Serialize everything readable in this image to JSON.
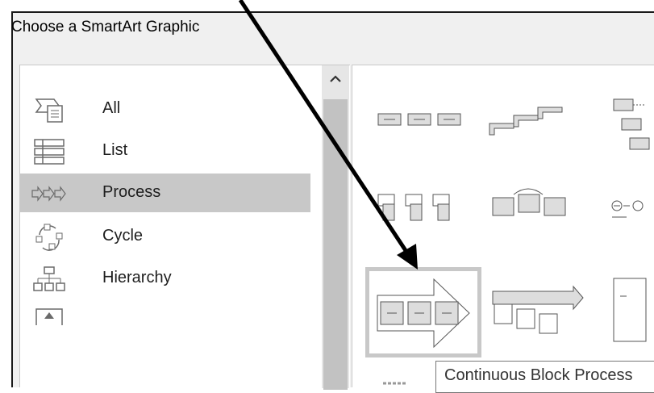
{
  "dialog": {
    "title": "Choose a SmartArt Graphic"
  },
  "categories": [
    {
      "label": "All",
      "icon": "all-icon",
      "selected": false
    },
    {
      "label": "List",
      "icon": "list-icon",
      "selected": false
    },
    {
      "label": "Process",
      "icon": "process-icon",
      "selected": true
    },
    {
      "label": "Cycle",
      "icon": "cycle-icon",
      "selected": false
    },
    {
      "label": "Hierarchy",
      "icon": "hierarchy-icon",
      "selected": false
    },
    {
      "label": "",
      "icon": "relationship-icon",
      "selected": false
    }
  ],
  "layouts": [
    {
      "icon": "basic-process-icon"
    },
    {
      "icon": "step-up-process-icon"
    },
    {
      "icon": "alternating-flow-icon"
    },
    {
      "icon": "accent-process-icon"
    },
    {
      "icon": "basic-chevron-icon"
    },
    {
      "icon": "circle-process-icon"
    },
    {
      "icon": "continuous-block-process-icon",
      "selected": true
    },
    {
      "icon": "increasing-arrow-process-icon"
    },
    {
      "icon": "segmented-process-icon"
    }
  ],
  "tooltip": {
    "text": "Continuous Block Process"
  },
  "colors": {
    "selection": "#c8c8c8",
    "dialog_bg": "#f0f0f0",
    "border": "#767676"
  }
}
